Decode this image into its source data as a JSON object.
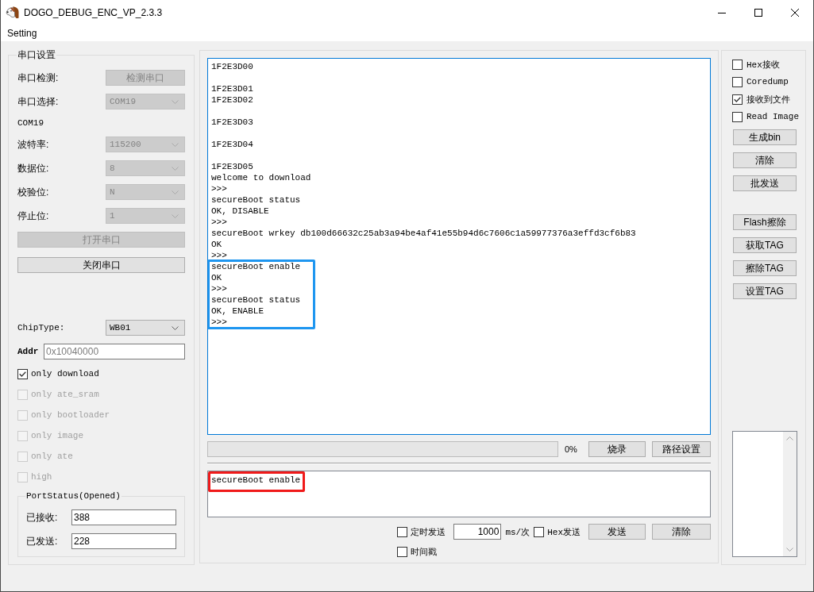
{
  "window": {
    "title": "DOGO_DEBUG_ENC_VP_2.3.3"
  },
  "menu": [
    "Setting"
  ],
  "serial_settings": {
    "title": "串口设置",
    "rows": [
      {
        "kind": "button",
        "label": "串口检测:",
        "value": "检测串口",
        "disabled": true
      },
      {
        "kind": "select",
        "label": "串口选择:",
        "value": "COM19",
        "disabled": true
      },
      {
        "kind": "text",
        "value": "COM19"
      },
      {
        "kind": "select",
        "label": "波特率:",
        "value": "115200",
        "disabled": true
      },
      {
        "kind": "select",
        "label": "数据位:",
        "value": "8",
        "disabled": true
      },
      {
        "kind": "select",
        "label": "校验位:",
        "value": "N",
        "disabled": true
      },
      {
        "kind": "select",
        "label": "停止位:",
        "value": "1",
        "disabled": true
      }
    ],
    "buttons": [
      {
        "label": "打开串口",
        "disabled": true
      },
      {
        "label": "关闭串口",
        "disabled": false
      }
    ],
    "chip_type": {
      "label": "ChipType:",
      "value": "WB01",
      "disabled": false
    },
    "addr": {
      "label": "Addr",
      "placeholder": "0x10040000"
    },
    "options": [
      {
        "label": "only download",
        "checked": true,
        "disabled": false
      },
      {
        "label": "only ate_sram",
        "checked": false,
        "disabled": true
      },
      {
        "label": "only bootloader",
        "checked": false,
        "disabled": true
      },
      {
        "label": "only image",
        "checked": false,
        "disabled": true
      },
      {
        "label": "only ate",
        "checked": false,
        "disabled": true
      },
      {
        "label": "high",
        "checked": false,
        "disabled": true
      }
    ],
    "port_status": {
      "title": "PortStatus(Opened)",
      "fields": [
        {
          "label": "已接收:",
          "value": "388"
        },
        {
          "label": "已发送:",
          "value": "228"
        }
      ]
    }
  },
  "log": {
    "focused": true,
    "paragraphs": [
      {
        "lines": [
          "1F2E3D00"
        ]
      },
      {
        "lines": [
          "1F2E3D01",
          "1F2E3D02"
        ]
      },
      {
        "lines": [
          "1F2E3D03"
        ]
      },
      {
        "lines": [
          "1F2E3D04"
        ]
      },
      {
        "lines": [
          "1F2E3D05",
          "welcome to download",
          ">>>",
          "secureBoot status",
          "OK, DISABLE",
          ">>>",
          "secureBoot wrkey db100d66632c25ab3a94be4af41e55b94d6c7606c1a59977376a3effd3cf6b83",
          "OK",
          ">>>"
        ],
        "framed_lines": [
          "secureBoot enable",
          "OK",
          ">>>",
          "secureBoot status",
          "OK, ENABLE",
          ">>>"
        ]
      }
    ]
  },
  "flash": {
    "level": 0,
    "reading": "0%",
    "buttons": [
      "烧录",
      "路径设置"
    ]
  },
  "send": {
    "value": "secureBoot enable",
    "highlighted": true,
    "timed_send": {
      "label": "定时发送",
      "checked": false
    },
    "interval": "1000",
    "unit": "ms/次",
    "hex_send": {
      "label": "Hex发送",
      "checked": false
    },
    "buttons": [
      "发送",
      "清除"
    ],
    "timestamp": {
      "label": "时间戳",
      "checked": false
    }
  },
  "receive_options": [
    {
      "label": "Hex接收",
      "checked": false
    },
    {
      "label": "Coredump",
      "checked": false
    },
    {
      "label": "接收到文件",
      "checked": true
    },
    {
      "label": "Read Image",
      "checked": false
    }
  ],
  "tool_button_groups": [
    [
      "生成bin",
      "清除",
      "批发送"
    ],
    [
      "Flash擦除",
      "获取TAG",
      "擦除TAG",
      "设置TAG"
    ]
  ]
}
